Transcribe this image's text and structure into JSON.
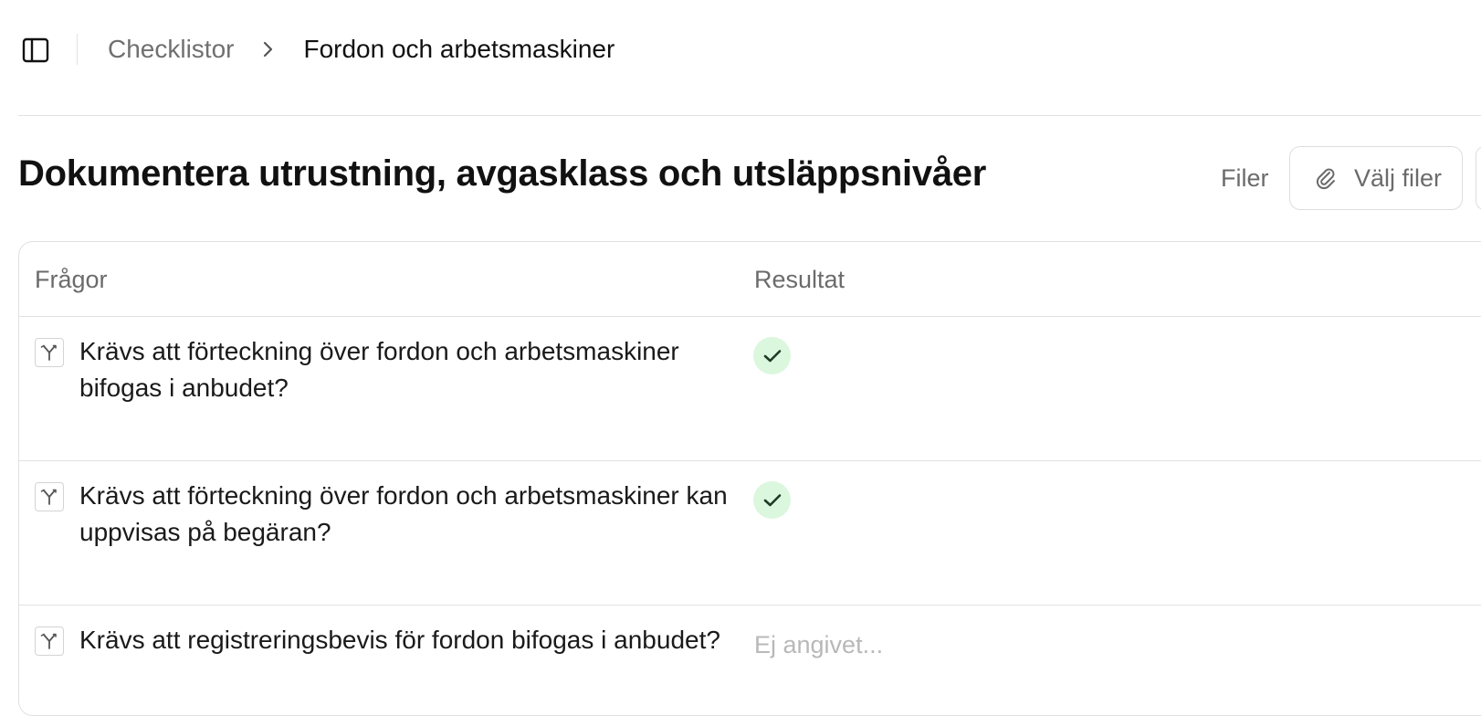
{
  "breadcrumb": {
    "parent": "Checklistor",
    "current": "Fordon och arbetsmaskiner"
  },
  "page": {
    "title": "Dokumentera utrustning, avgasklass och utsläppsnivåer"
  },
  "files": {
    "label": "Filer",
    "button_label": "Välj filer"
  },
  "table": {
    "headers": {
      "questions": "Frågor",
      "result": "Resultat"
    },
    "rows": [
      {
        "question": "Krävs att förteckning över fordon och arbetsmaskiner bifogas i anbudet?",
        "result": "checked"
      },
      {
        "question": "Krävs att förteckning över fordon och arbetsmaskiner kan uppvisas på begäran?",
        "result": "checked"
      },
      {
        "question": "Krävs att registreringsbevis för fordon bifogas i anbudet?",
        "result_placeholder": "Ej angivet..."
      }
    ]
  },
  "icons": {
    "sidebar_toggle": "sidebar-toggle-icon",
    "breadcrumb_separator": "chevron-right-icon",
    "files_button": "paperclip-icon",
    "row_type": "branch-icon",
    "result_checked": "check-icon"
  },
  "colors": {
    "check_background": "#dbf7de",
    "check_mark": "#1f3b26",
    "muted_text": "#6b6b6b",
    "placeholder_text": "#b8b8b8",
    "border": "#e2e2e2"
  }
}
